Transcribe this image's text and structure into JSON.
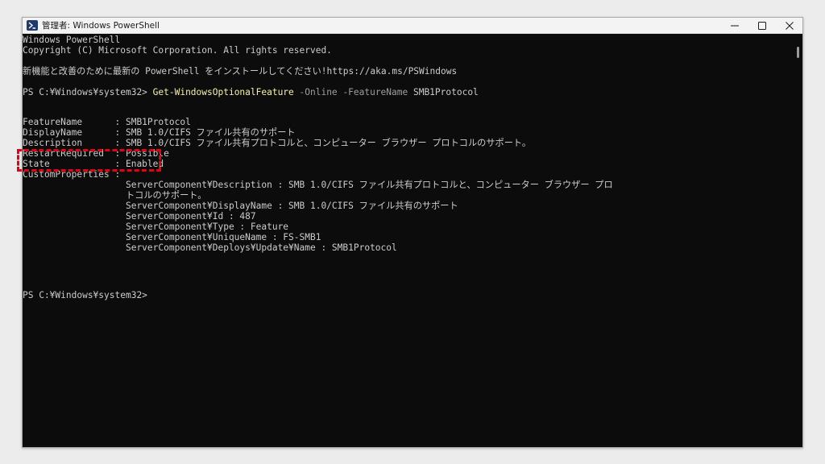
{
  "window": {
    "title": "管理者: Windows PowerShell"
  },
  "terminal": {
    "lines": [
      "Windows PowerShell",
      "Copyright (C) Microsoft Corporation. All rights reserved.",
      "",
      "新機能と改善のために最新の PowerShell をインストールしてください!https://aka.ms/PSWindows",
      "",
      "",
      "",
      "",
      "FeatureName      : SMB1Protocol",
      "DisplayName      : SMB 1.0/CIFS ファイル共有のサポート",
      "Description      : SMB 1.0/CIFS ファイル共有プロトコルと、コンピューター ブラウザー プロトコルのサポート。",
      "RestartRequired  : Possible",
      "State            : Enabled",
      "CustomProperties :",
      "                   ServerComponent¥Description : SMB 1.0/CIFS ファイル共有プロトコルと、コンピューター ブラウザー プロ",
      "                   トコルのサポート。",
      "                   ServerComponent¥DisplayName : SMB 1.0/CIFS ファイル共有のサポート",
      "                   ServerComponent¥Id : 487",
      "                   ServerComponent¥Type : Feature",
      "                   ServerComponent¥UniqueName : FS-SMB1",
      "                   ServerComponent¥Deploys¥Update¥Name : SMB1Protocol",
      "",
      "",
      "",
      "",
      "",
      "PS C:¥Windows¥system32>"
    ],
    "command_line": {
      "prompt": "PS C:¥Windows¥system32> ",
      "cmdlet": "Get-WindowsOptionalFeature",
      "param1": " -Online",
      "param2": " -FeatureName",
      "value": " SMB1Protocol"
    }
  },
  "colors": {
    "background": "#0c0c0c",
    "text": "#cccccc",
    "cmdlet": "#f9f1a5",
    "parameter": "#9e9e9e",
    "highlight": "#e60012"
  },
  "icons": {
    "app": "powershell-icon",
    "minimize": "minimize-icon",
    "maximize": "maximize-icon",
    "close": "close-icon"
  }
}
